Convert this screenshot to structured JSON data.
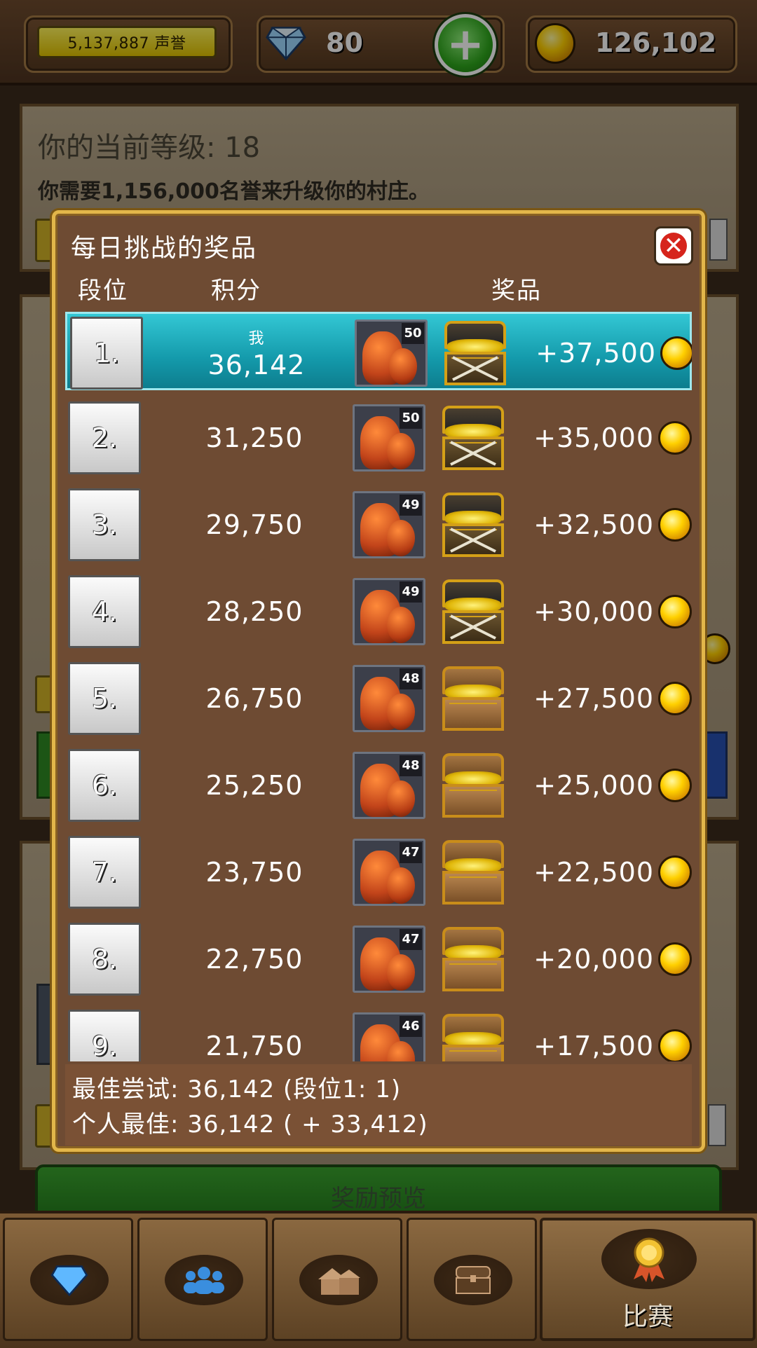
{
  "topbar": {
    "fame": "5,137,887 声誉",
    "gems": "80",
    "gold": "126,102"
  },
  "background": {
    "level_title": "你的当前等级: 18",
    "need_text": "你需要1,156,000名誉来升级你的村庄。",
    "green_button": "奖励预览"
  },
  "modal": {
    "title": "每日挑战的奖品",
    "headers": {
      "rank": "段位",
      "score": "积分",
      "prize": "奖品"
    },
    "me_label": "我",
    "rows": [
      {
        "rank": "1.",
        "score": "36,142",
        "dragon_level": "50",
        "chest": "iron",
        "reward": "+37,500"
      },
      {
        "rank": "2.",
        "score": "31,250",
        "dragon_level": "50",
        "chest": "iron",
        "reward": "+35,000"
      },
      {
        "rank": "3.",
        "score": "29,750",
        "dragon_level": "49",
        "chest": "iron",
        "reward": "+32,500"
      },
      {
        "rank": "4.",
        "score": "28,250",
        "dragon_level": "49",
        "chest": "iron",
        "reward": "+30,000"
      },
      {
        "rank": "5.",
        "score": "26,750",
        "dragon_level": "48",
        "chest": "wood",
        "reward": "+27,500"
      },
      {
        "rank": "6.",
        "score": "25,250",
        "dragon_level": "48",
        "chest": "wood",
        "reward": "+25,000"
      },
      {
        "rank": "7.",
        "score": "23,750",
        "dragon_level": "47",
        "chest": "wood",
        "reward": "+22,500"
      },
      {
        "rank": "8.",
        "score": "22,750",
        "dragon_level": "47",
        "chest": "wood",
        "reward": "+20,000"
      },
      {
        "rank": "9.",
        "score": "21,750",
        "dragon_level": "46",
        "chest": "wood",
        "reward": "+17,500"
      }
    ],
    "best_try": "最佳尝试: 36,142 (段位1: 1)",
    "personal_best": "个人最佳: 36,142 ( + 33,412)"
  },
  "nav": {
    "contest_label": "比赛",
    "icons": [
      "gem-icon",
      "people-icon",
      "house-icon",
      "chest-icon",
      "medal-icon"
    ]
  },
  "colors": {
    "accent_gold": "#e2b64a",
    "highlight_row": "#1ea8b8",
    "modal_bg": "#6e4b33"
  }
}
